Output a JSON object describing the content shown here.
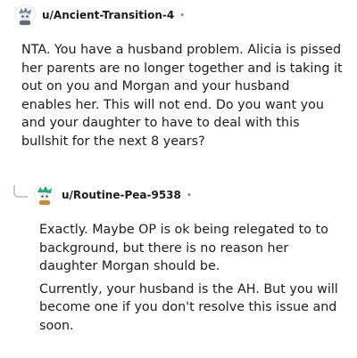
{
  "comments": [
    {
      "username": "u/Ancient-Transition-4",
      "separator": "•",
      "paragraphs": [
        "NTA. You have a husband problem. Alicia is pissed her parents are no longer together and is taking it out on you and Morgan and your husband enables her. This will not end. Do you want you and your daughter to have to deal with this bullshit for the next 8 years?"
      ]
    },
    {
      "username": "u/Routine-Pea-9538",
      "separator": "•",
      "paragraphs": [
        "Exactly. Maybe OP is ok being relegated to to background, but there is no reason her daughter Morgan should be.",
        "Currently, your husband is the AH. But you will become one if you don't resolve this issue and soon."
      ]
    }
  ],
  "icons": {
    "avatar_1": "snoo-avatar-icon",
    "avatar_2": "snoo-avatar-icon",
    "reply": "reply-arrow-icon"
  },
  "colors": {
    "text": "#1c1c1c",
    "meta": "#7c7c7c",
    "thread_line": "#c9ced3"
  }
}
